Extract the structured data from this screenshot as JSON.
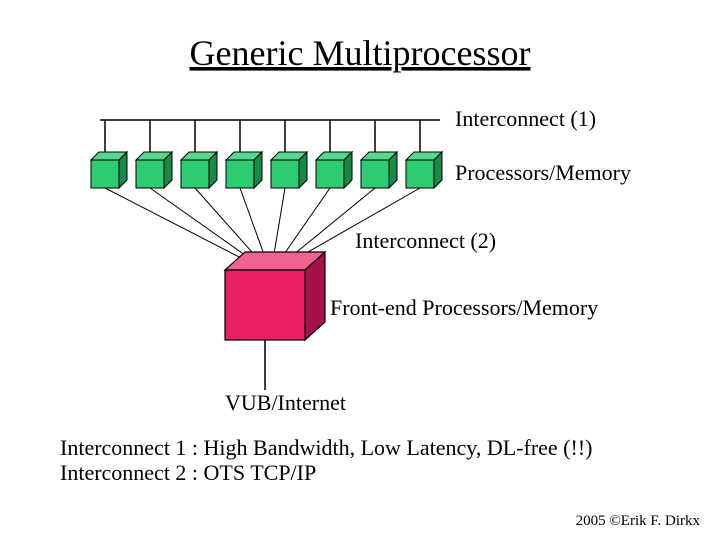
{
  "title": "Generic Multiprocessor",
  "labels": {
    "ic1": "Interconnect (1)",
    "procmem": "Processors/Memory",
    "ic2": "Interconnect (2)",
    "frontend": "Front-end Processors/Memory",
    "vub": "VUB/Internet"
  },
  "notes": {
    "line1": "Interconnect 1 : High Bandwidth, Low Latency, DL-free (!!)",
    "line2": "Interconnect 2 : OTS TCP/IP"
  },
  "footer": "2005 ©Erik F. Dirkx",
  "diagram": {
    "small_boxes": {
      "count": 8,
      "fill": "#2ECC71",
      "shade": "#188A47",
      "outline": "#000000"
    },
    "big_box": {
      "fill": "#E91E63",
      "shade": "#A3124A",
      "outline": "#000000"
    }
  }
}
